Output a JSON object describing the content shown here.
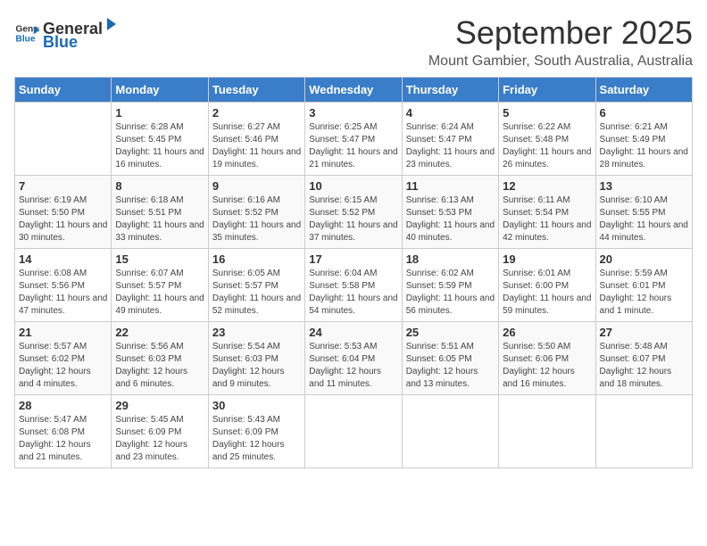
{
  "logo": {
    "general": "General",
    "blue": "Blue"
  },
  "title": "September 2025",
  "subtitle": "Mount Gambier, South Australia, Australia",
  "headers": [
    "Sunday",
    "Monday",
    "Tuesday",
    "Wednesday",
    "Thursday",
    "Friday",
    "Saturday"
  ],
  "weeks": [
    [
      {
        "day": "",
        "sunrise": "",
        "sunset": "",
        "daylight": ""
      },
      {
        "day": "1",
        "sunrise": "6:28 AM",
        "sunset": "5:45 PM",
        "daylight": "11 hours and 16 minutes."
      },
      {
        "day": "2",
        "sunrise": "6:27 AM",
        "sunset": "5:46 PM",
        "daylight": "11 hours and 19 minutes."
      },
      {
        "day": "3",
        "sunrise": "6:25 AM",
        "sunset": "5:47 PM",
        "daylight": "11 hours and 21 minutes."
      },
      {
        "day": "4",
        "sunrise": "6:24 AM",
        "sunset": "5:47 PM",
        "daylight": "11 hours and 23 minutes."
      },
      {
        "day": "5",
        "sunrise": "6:22 AM",
        "sunset": "5:48 PM",
        "daylight": "11 hours and 26 minutes."
      },
      {
        "day": "6",
        "sunrise": "6:21 AM",
        "sunset": "5:49 PM",
        "daylight": "11 hours and 28 minutes."
      }
    ],
    [
      {
        "day": "7",
        "sunrise": "6:19 AM",
        "sunset": "5:50 PM",
        "daylight": "11 hours and 30 minutes."
      },
      {
        "day": "8",
        "sunrise": "6:18 AM",
        "sunset": "5:51 PM",
        "daylight": "11 hours and 33 minutes."
      },
      {
        "day": "9",
        "sunrise": "6:16 AM",
        "sunset": "5:52 PM",
        "daylight": "11 hours and 35 minutes."
      },
      {
        "day": "10",
        "sunrise": "6:15 AM",
        "sunset": "5:52 PM",
        "daylight": "11 hours and 37 minutes."
      },
      {
        "day": "11",
        "sunrise": "6:13 AM",
        "sunset": "5:53 PM",
        "daylight": "11 hours and 40 minutes."
      },
      {
        "day": "12",
        "sunrise": "6:11 AM",
        "sunset": "5:54 PM",
        "daylight": "11 hours and 42 minutes."
      },
      {
        "day": "13",
        "sunrise": "6:10 AM",
        "sunset": "5:55 PM",
        "daylight": "11 hours and 44 minutes."
      }
    ],
    [
      {
        "day": "14",
        "sunrise": "6:08 AM",
        "sunset": "5:56 PM",
        "daylight": "11 hours and 47 minutes."
      },
      {
        "day": "15",
        "sunrise": "6:07 AM",
        "sunset": "5:57 PM",
        "daylight": "11 hours and 49 minutes."
      },
      {
        "day": "16",
        "sunrise": "6:05 AM",
        "sunset": "5:57 PM",
        "daylight": "11 hours and 52 minutes."
      },
      {
        "day": "17",
        "sunrise": "6:04 AM",
        "sunset": "5:58 PM",
        "daylight": "11 hours and 54 minutes."
      },
      {
        "day": "18",
        "sunrise": "6:02 AM",
        "sunset": "5:59 PM",
        "daylight": "11 hours and 56 minutes."
      },
      {
        "day": "19",
        "sunrise": "6:01 AM",
        "sunset": "6:00 PM",
        "daylight": "11 hours and 59 minutes."
      },
      {
        "day": "20",
        "sunrise": "5:59 AM",
        "sunset": "6:01 PM",
        "daylight": "12 hours and 1 minute."
      }
    ],
    [
      {
        "day": "21",
        "sunrise": "5:57 AM",
        "sunset": "6:02 PM",
        "daylight": "12 hours and 4 minutes."
      },
      {
        "day": "22",
        "sunrise": "5:56 AM",
        "sunset": "6:03 PM",
        "daylight": "12 hours and 6 minutes."
      },
      {
        "day": "23",
        "sunrise": "5:54 AM",
        "sunset": "6:03 PM",
        "daylight": "12 hours and 9 minutes."
      },
      {
        "day": "24",
        "sunrise": "5:53 AM",
        "sunset": "6:04 PM",
        "daylight": "12 hours and 11 minutes."
      },
      {
        "day": "25",
        "sunrise": "5:51 AM",
        "sunset": "6:05 PM",
        "daylight": "12 hours and 13 minutes."
      },
      {
        "day": "26",
        "sunrise": "5:50 AM",
        "sunset": "6:06 PM",
        "daylight": "12 hours and 16 minutes."
      },
      {
        "day": "27",
        "sunrise": "5:48 AM",
        "sunset": "6:07 PM",
        "daylight": "12 hours and 18 minutes."
      }
    ],
    [
      {
        "day": "28",
        "sunrise": "5:47 AM",
        "sunset": "6:08 PM",
        "daylight": "12 hours and 21 minutes."
      },
      {
        "day": "29",
        "sunrise": "5:45 AM",
        "sunset": "6:09 PM",
        "daylight": "12 hours and 23 minutes."
      },
      {
        "day": "30",
        "sunrise": "5:43 AM",
        "sunset": "6:09 PM",
        "daylight": "12 hours and 25 minutes."
      },
      {
        "day": "",
        "sunrise": "",
        "sunset": "",
        "daylight": ""
      },
      {
        "day": "",
        "sunrise": "",
        "sunset": "",
        "daylight": ""
      },
      {
        "day": "",
        "sunrise": "",
        "sunset": "",
        "daylight": ""
      },
      {
        "day": "",
        "sunrise": "",
        "sunset": "",
        "daylight": ""
      }
    ]
  ],
  "labels": {
    "sunrise_prefix": "Sunrise: ",
    "sunset_prefix": "Sunset: ",
    "daylight_prefix": "Daylight: "
  }
}
